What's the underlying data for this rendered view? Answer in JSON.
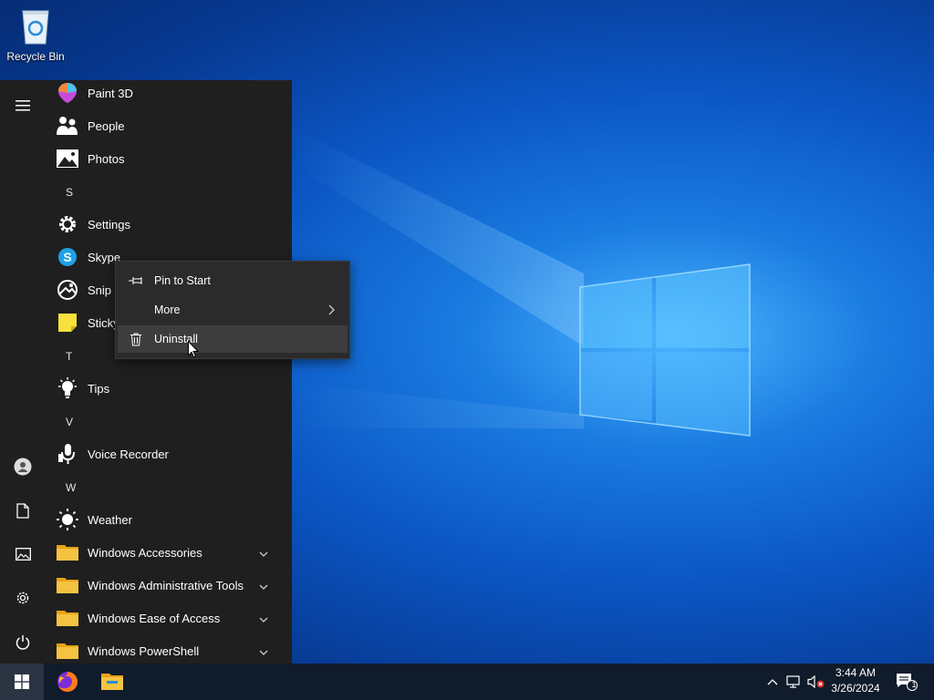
{
  "desktop": {
    "recycle_bin_label": "Recycle Bin"
  },
  "start_menu": {
    "rail": {
      "icons": [
        "hamburger-icon",
        "user-icon",
        "document-icon",
        "pictures-icon",
        "gear-icon",
        "power-icon"
      ]
    },
    "apps": {
      "paint3d": "Paint 3D",
      "people": "People",
      "photos": "Photos",
      "letter_s": "S",
      "settings": "Settings",
      "skype": "Skype",
      "snip": "Snip &",
      "sticky": "Sticky",
      "letter_t": "T",
      "tips": "Tips",
      "letter_v": "V",
      "voice_recorder": "Voice Recorder",
      "letter_w": "W",
      "weather": "Weather",
      "win_accessories": "Windows Accessories",
      "win_admin_tools": "Windows Administrative Tools",
      "win_ease_access": "Windows Ease of Access",
      "win_powershell": "Windows PowerShell"
    }
  },
  "context_menu": {
    "pin_to_start": "Pin to Start",
    "more": "More",
    "uninstall": "Uninstall"
  },
  "taskbar": {
    "apps": [
      "firefox-icon",
      "file-explorer-icon"
    ],
    "tray_icons": [
      "chevron-up-icon",
      "network-icon",
      "volume-muted-icon"
    ],
    "time": "3:44 AM",
    "date": "3/26/2024",
    "notification_count": "1"
  },
  "colors": {
    "menu_bg": "#1f1f1f",
    "context_bg": "#2b2b2b",
    "taskbar_bg": "#101b2b",
    "folder_yellow": "#f5c342",
    "accent_blue": "#0a66d8"
  }
}
